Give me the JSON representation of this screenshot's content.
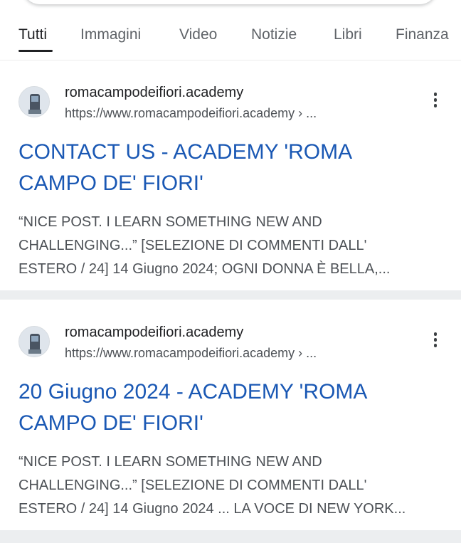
{
  "tabs": [
    "Tutti",
    "Immagini",
    "Video",
    "Notizie",
    "Libri",
    "Finanza"
  ],
  "active_tab": "Tutti",
  "results": [
    {
      "site_name": "romacampodeifiori.academy",
      "url": "https://www.romacampodeifiori.academy › ...",
      "title_lines": [
        "CONTACT US - ACADEMY 'ROMA",
        "CAMPO DE' FIORI'"
      ],
      "snippet_lines": [
        "“NICE POST. I LEARN SOMETHING NEW AND",
        "CHALLENGING...” [SELEZIONE DI COMMENTI DALL'",
        "ESTERO / 24] 14 Giugno 2024; OGNI DONNA È BELLA,..."
      ],
      "icon": "site-favicon"
    },
    {
      "site_name": "romacampodeifiori.academy",
      "url": "https://www.romacampodeifiori.academy › ...",
      "title_lines": [
        "20 Giugno 2024 - ACADEMY 'ROMA",
        "CAMPO DE' FIORI'"
      ],
      "snippet_lines": [
        "“NICE POST. I LEARN SOMETHING NEW AND",
        "CHALLENGING...” [SELEZIONE DI COMMENTI DALL'",
        "ESTERO / 24] 14 Giugno 2024 ... LA VOCE DI NEW YORK..."
      ],
      "icon": "site-favicon"
    }
  ],
  "colors": {
    "link": "#1a58b4",
    "text": "#202124",
    "secondary": "#4d5156",
    "divider": "#eceef0"
  }
}
